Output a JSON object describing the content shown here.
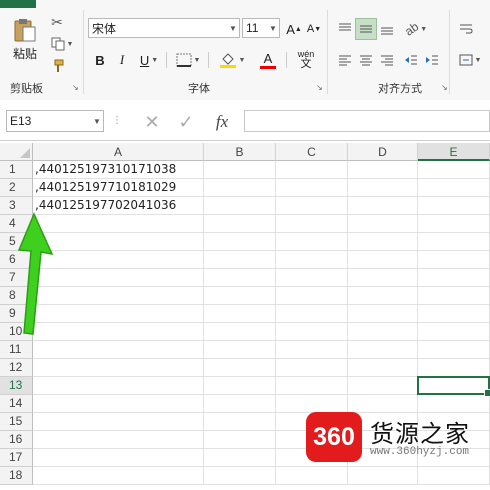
{
  "ribbon": {
    "clipboard": {
      "paste_label": "粘贴",
      "group_label": "剪贴板"
    },
    "font": {
      "font_name": "宋体",
      "font_size": "11",
      "grow_label": "A",
      "shrink_label": "A",
      "bold": "B",
      "italic": "I",
      "underline": "U",
      "font_color_label": "A",
      "phonetic_top": "wén",
      "phonetic_bottom": "文",
      "group_label": "字体"
    },
    "alignment": {
      "group_label": "对齐方式"
    }
  },
  "formula_bar": {
    "name_box": "E13",
    "fx_label": "fx",
    "formula": ""
  },
  "grid": {
    "columns": [
      "A",
      "B",
      "C",
      "D",
      "E"
    ],
    "selected_column": "E",
    "rows": [
      "1",
      "2",
      "3",
      "4",
      "5",
      "6",
      "7",
      "8",
      "9",
      "10",
      "11",
      "12",
      "13",
      "14",
      "15",
      "16",
      "17",
      "18"
    ],
    "selected_row": "13",
    "active_cell": "E13",
    "cells": {
      "A1": ",440125197310171038",
      "A2": ",440125197710181029",
      "A3": ",440125197702041036"
    }
  },
  "watermark": {
    "logo_text": "360",
    "title": "货源之家",
    "url": "www.360hyzj.com"
  },
  "colors": {
    "excel_green": "#217346",
    "arrow_green": "#3fcf1f",
    "logo_red": "#e21c1c"
  }
}
